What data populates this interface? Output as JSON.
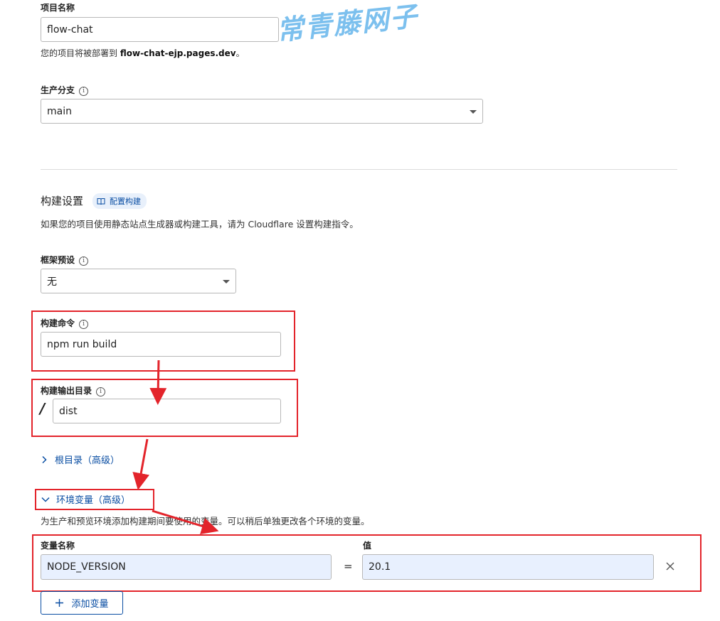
{
  "watermark": "常青藤网子",
  "project": {
    "name_label": "项目名称",
    "name_value": "flow-chat",
    "deploy_hint_prefix": "您的项目将被部署到",
    "deploy_hint_domain": "flow-chat-ejp.pages.dev",
    "deploy_hint_suffix": "。"
  },
  "branch": {
    "label": "生产分支",
    "value": "main"
  },
  "build_settings": {
    "title": "构建设置",
    "config_badge": "配置构建",
    "description": "如果您的项目使用静态站点生成器或构建工具，请为 Cloudflare 设置构建指令。",
    "framework_label": "框架预设",
    "framework_value": "无",
    "command_label": "构建命令",
    "command_value": "npm run build",
    "output_label": "构建输出目录",
    "output_prefix": "/",
    "output_value": "dist",
    "root_dir_link": "根目录（高级）",
    "env_vars_link": "环境变量（高级）",
    "env_description": "为生产和预览环境添加构建期间要使用的变量。可以稍后单独更改各个环境的变量。",
    "var_name_header": "变量名称",
    "var_value_header": "值",
    "var_name": "NODE_VERSION",
    "equals": "=",
    "var_value": "20.1",
    "add_variable": "添加变量"
  },
  "colors": {
    "accent": "#0a4ea3",
    "annotation_red": "#e3242b",
    "filled_input": "#e8f0fe"
  },
  "icons": {
    "info": "info-icon",
    "book": "book-icon",
    "chevron_right": "chevron-right-icon",
    "chevron_down": "chevron-down-icon",
    "close": "close-icon",
    "plus": "plus-icon"
  }
}
